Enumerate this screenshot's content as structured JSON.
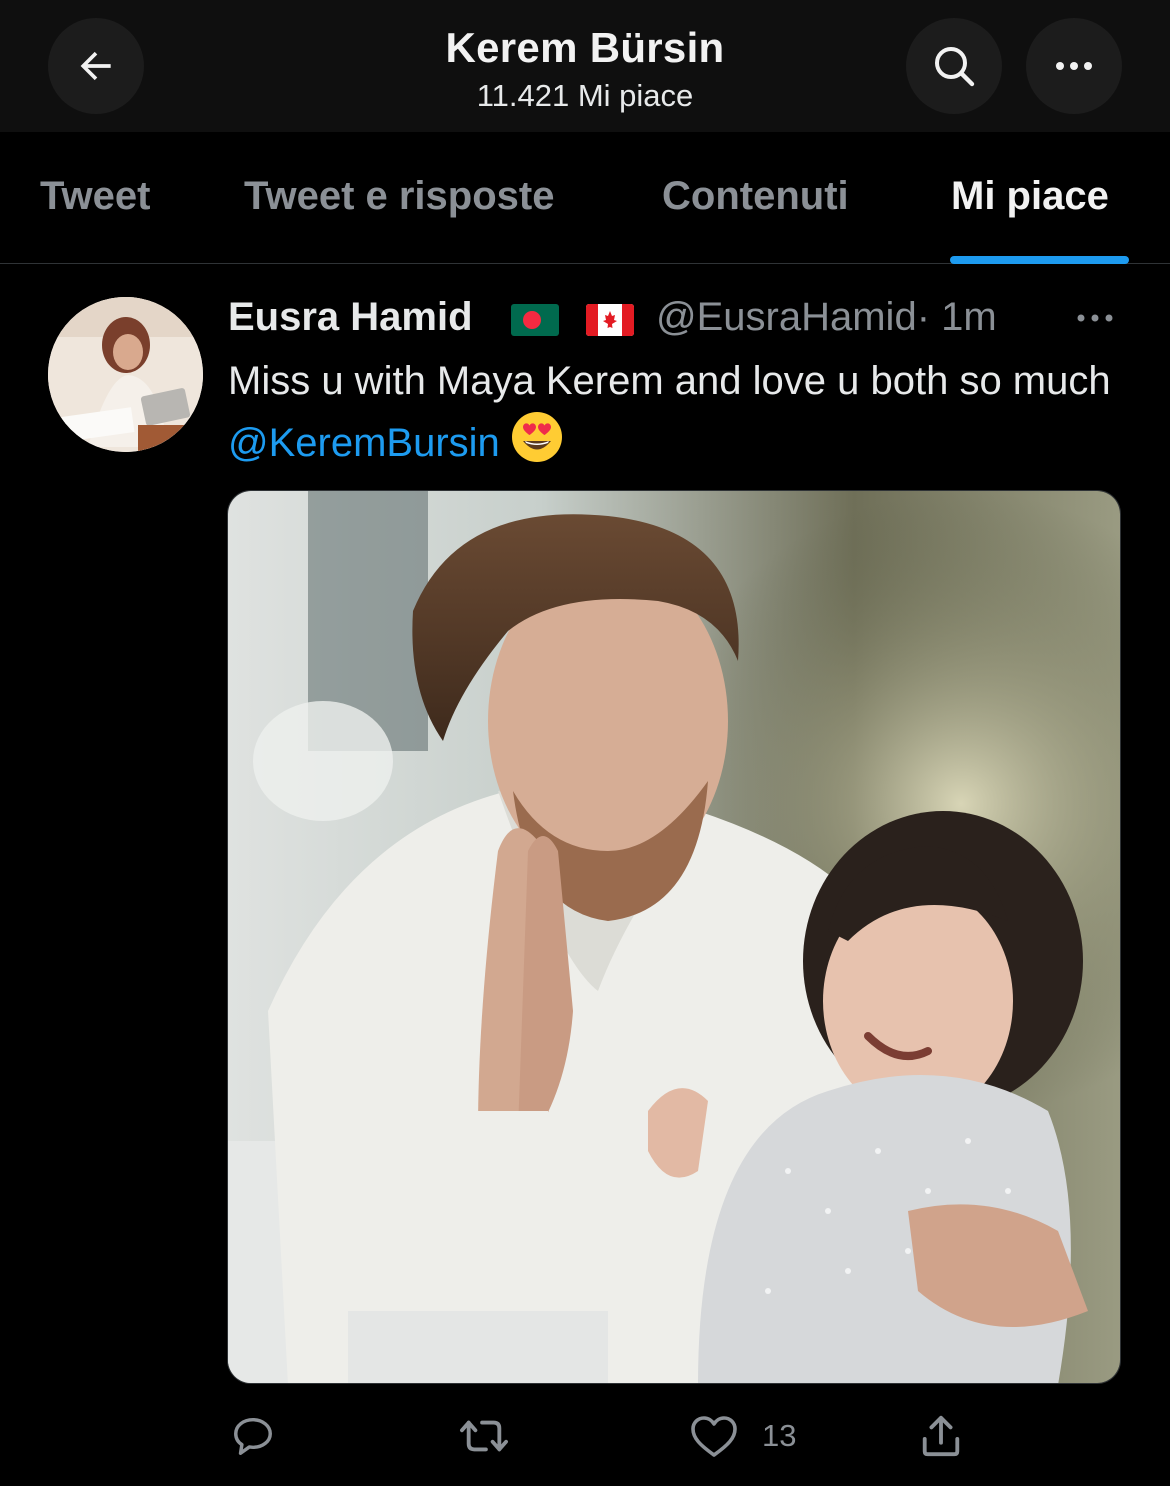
{
  "header": {
    "title": "Kerem Bürsin",
    "subtitle": "11.421 Mi piace",
    "back_icon": "arrow-left-icon",
    "search_icon": "search-icon",
    "more_icon": "more-horizontal-icon"
  },
  "tabs": [
    {
      "label": "Tweet",
      "active": false
    },
    {
      "label": "Tweet e risposte",
      "active": false
    },
    {
      "label": "Contenuti",
      "active": false
    },
    {
      "label": "Mi piace",
      "active": true
    }
  ],
  "tweet": {
    "author_name": "Eusra Hamid",
    "flags": [
      "flag-bangladesh",
      "flag-canada"
    ],
    "handle": "@EusraHamid",
    "time": "· 1m",
    "text_part1": "Miss u with Maya Kerem  and love u both so much ",
    "mention": "@KeremBursin",
    "emoji": "heart-eyes-emoji",
    "actions": {
      "reply_icon": "reply-icon",
      "retweet_icon": "retweet-icon",
      "like_icon": "heart-icon",
      "like_count": "13",
      "share_icon": "share-icon"
    }
  },
  "colors": {
    "accent": "#1d9bf0",
    "secondary_text": "#8b9096",
    "background": "#000000"
  }
}
